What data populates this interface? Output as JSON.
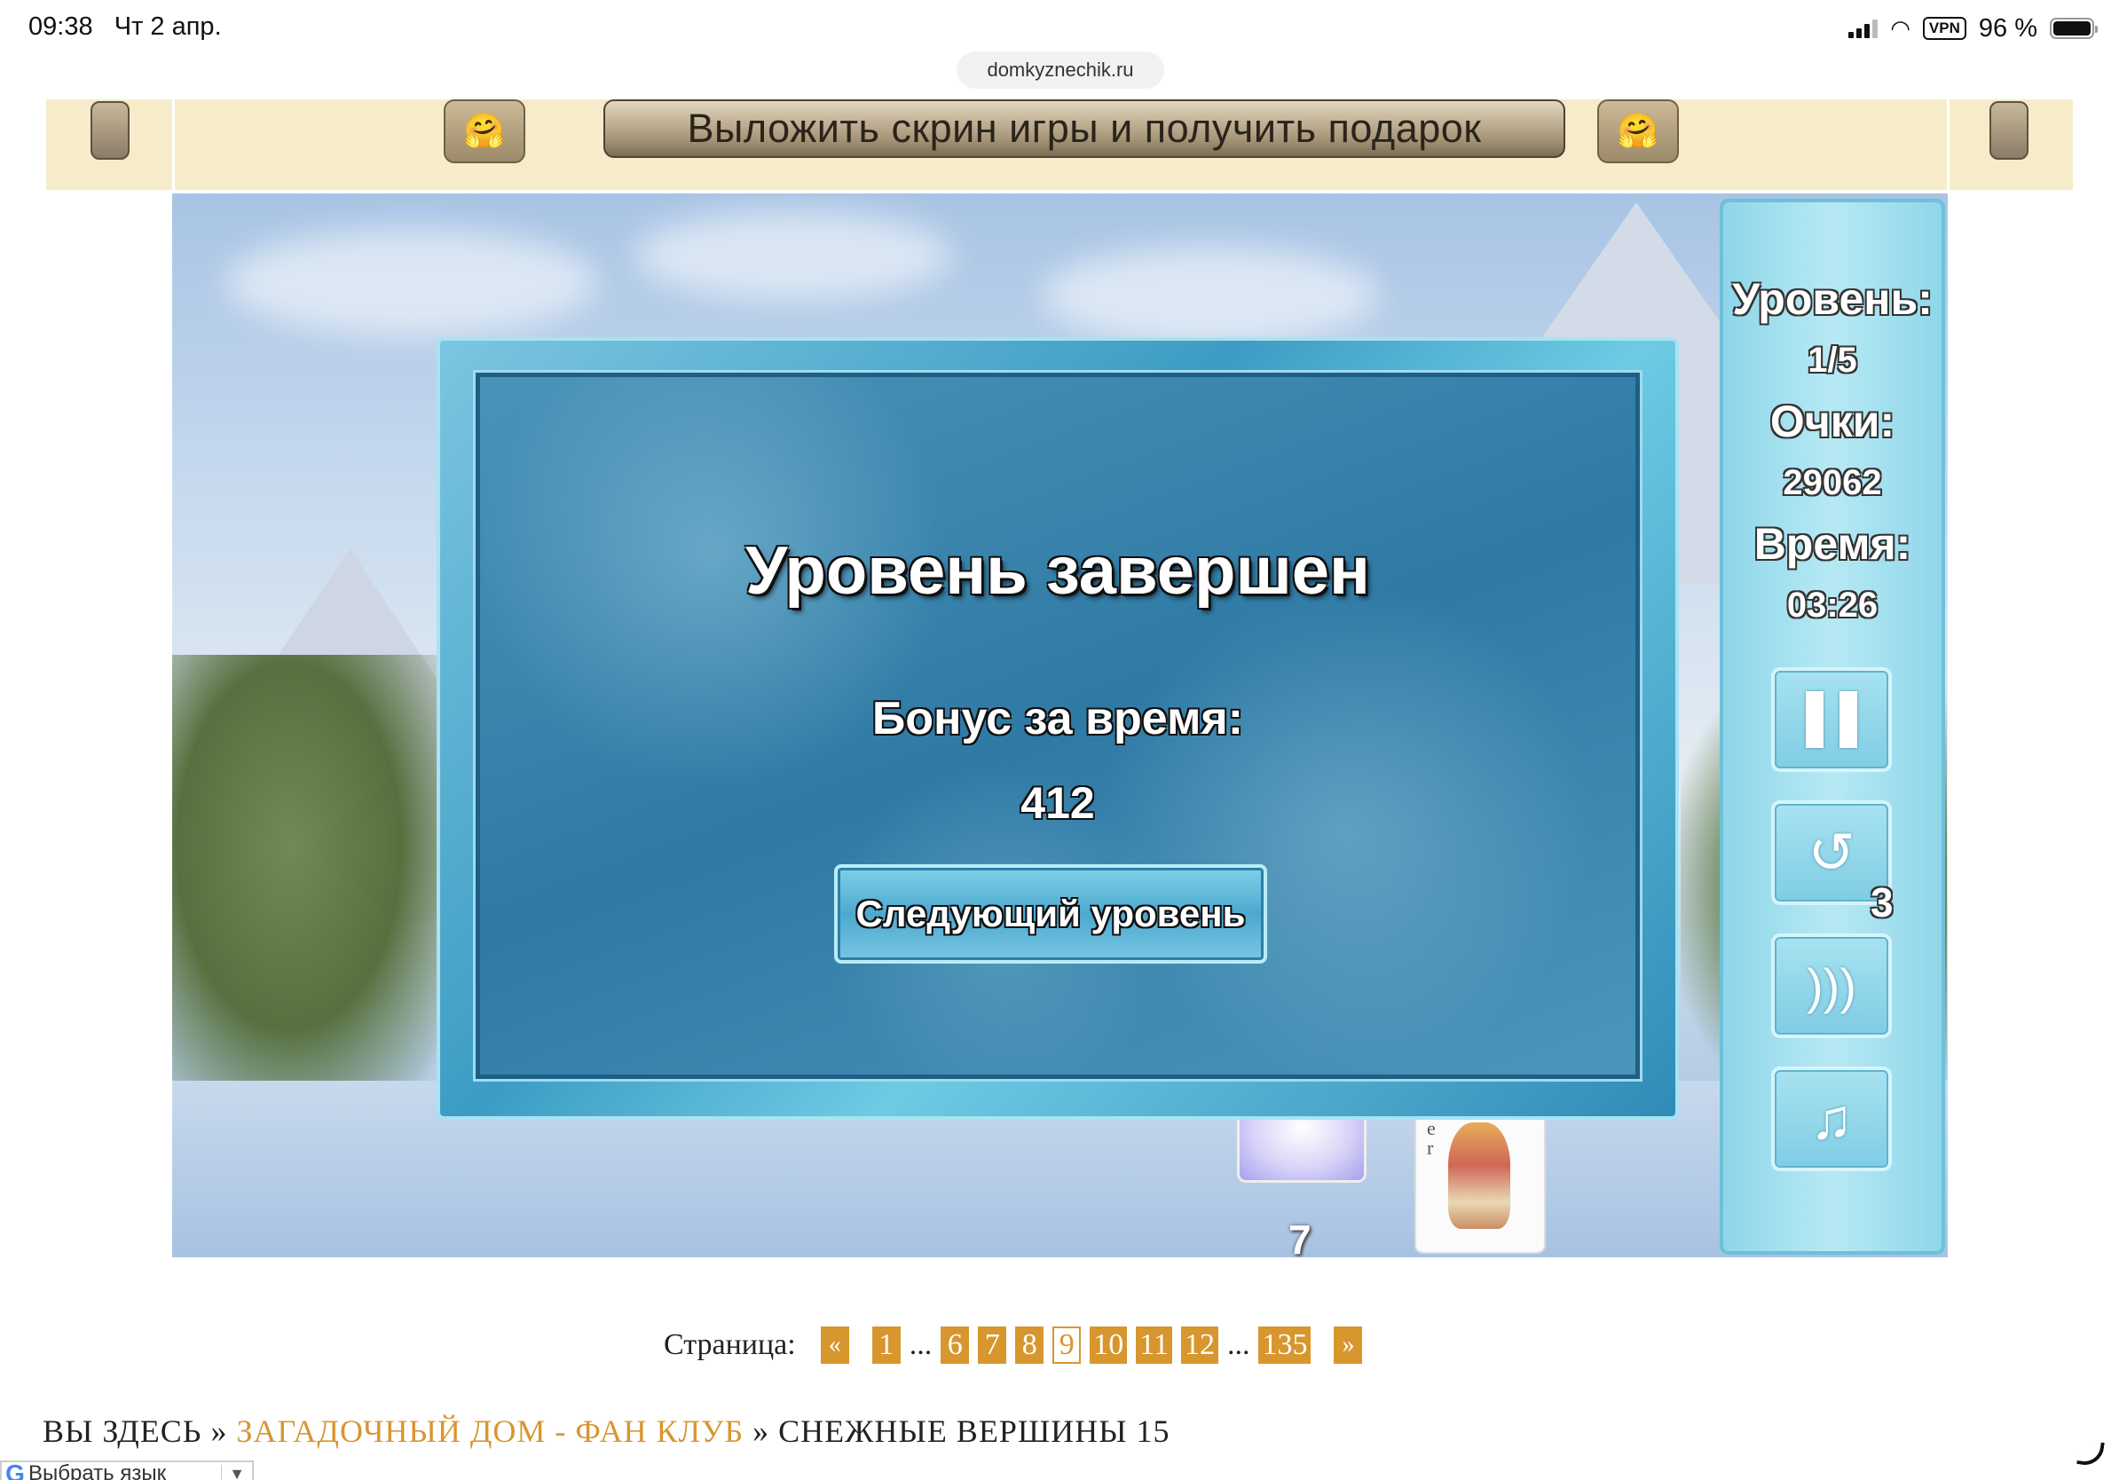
{
  "status_bar": {
    "time": "09:38",
    "date": "Чт 2 апр.",
    "vpn": "VPN",
    "battery": "96 %",
    "url": "domkyznechik.ru"
  },
  "promo": {
    "button_label": "Выложить скрин игры и получить подарок",
    "emoji_left": "🤗",
    "emoji_right": "🤗"
  },
  "dialog": {
    "title": "Уровень завершен",
    "bonus_label": "Бонус за время:",
    "bonus_value": "412",
    "next_button": "Следующий уровень"
  },
  "panel": {
    "level_label": "Уровень:",
    "level_value": "1/5",
    "score_label": "Очки:",
    "score_value": "29062",
    "time_label": "Время:",
    "time_value": "03:26",
    "undo_count": "3",
    "buttons": [
      "pause-icon",
      "undo-icon",
      "sound-icon",
      "music-icon"
    ]
  },
  "board": {
    "stack_count": "7",
    "card_letters": "e\nr"
  },
  "pagination": {
    "label": "Страница:",
    "prev": "«",
    "pages": [
      "1",
      "6",
      "7",
      "8",
      "9",
      "10",
      "11",
      "12",
      "135"
    ],
    "current": "9",
    "ellipsis": "...",
    "next": "»"
  },
  "breadcrumb": {
    "prefix": "ВЫ ЗДЕСЬ",
    "sep": "»",
    "link": "ЗАГАДОЧНЫЙ ДОМ - ФАН КЛУБ",
    "current": "СНЕЖНЫЕ ВЕРШИНЫ 15"
  },
  "translate": {
    "label": "Выбрать язык",
    "arrow": "▼"
  },
  "colors": {
    "link_orange": "#d8962e",
    "banner_bg": "#f6ecca",
    "ice_blue": "#3d9cc4"
  }
}
